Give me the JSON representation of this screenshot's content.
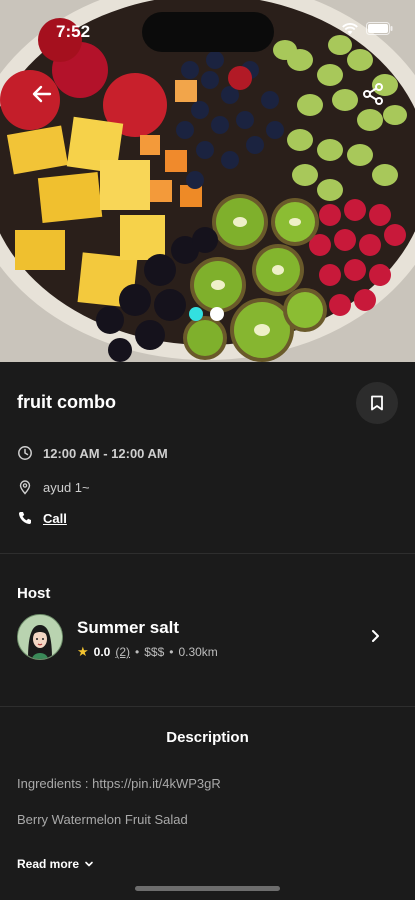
{
  "status_bar": {
    "time": "7:52"
  },
  "hero": {
    "carousel_total": 2,
    "carousel_index": 0,
    "active_dot_color": "#33e0e0"
  },
  "event": {
    "title": "fruit combo",
    "time_range": "12:00 AM - 12:00 AM",
    "location": "ayud 1~",
    "call_label": "Call"
  },
  "host": {
    "heading": "Host",
    "name": "Summer salt",
    "rating": "0.0",
    "review_count": "(2)",
    "price": "$$$",
    "distance": "0.30km"
  },
  "description": {
    "heading": "Description",
    "lines": [
      "Ingredients : https://pin.it/4kWP3gR",
      "Berry Watermelon Fruit Salad"
    ],
    "read_more": "Read more"
  },
  "icons": {
    "back": "arrow-left-icon",
    "share": "share-icon",
    "bookmark": "bookmark-icon",
    "clock": "clock-icon",
    "location": "location-pin-icon",
    "phone": "phone-icon",
    "star": "star-icon",
    "chevron_right": "chevron-right-icon",
    "chevron_down": "chevron-down-icon"
  }
}
